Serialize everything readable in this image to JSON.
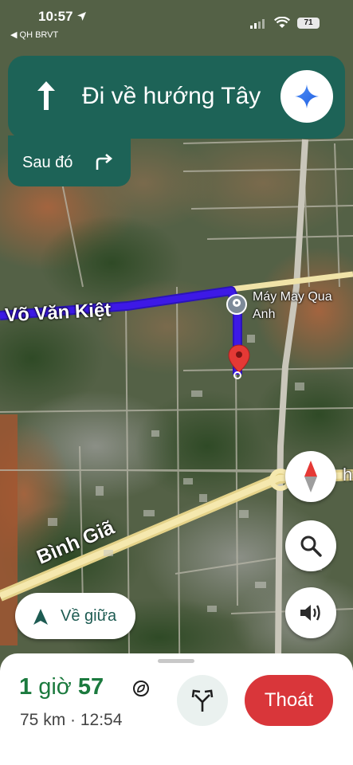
{
  "status_bar": {
    "time": "10:57",
    "back_app": "◀ QH BRVT",
    "battery": "71"
  },
  "navigation": {
    "instruction": "Đi về hướng Tây",
    "then_label": "Sau đó",
    "banner_color": "#1d6357"
  },
  "map": {
    "road_labels": [
      "Võ Văn Kiệt",
      "Bình Giã"
    ],
    "place_label_line1": "Máy May Qua",
    "place_label_line2": "Anh",
    "edge_label": "h",
    "route_color": "#3d19e6"
  },
  "controls": {
    "recenter_label": "Về giữa"
  },
  "trip": {
    "duration_hours": "1",
    "hours_unit": "giờ",
    "duration_minutes": "57",
    "summary": "75 km · 12:54",
    "exit_label": "Thoát",
    "eta_color": "#1b7a3e",
    "exit_color": "#d9363a"
  }
}
